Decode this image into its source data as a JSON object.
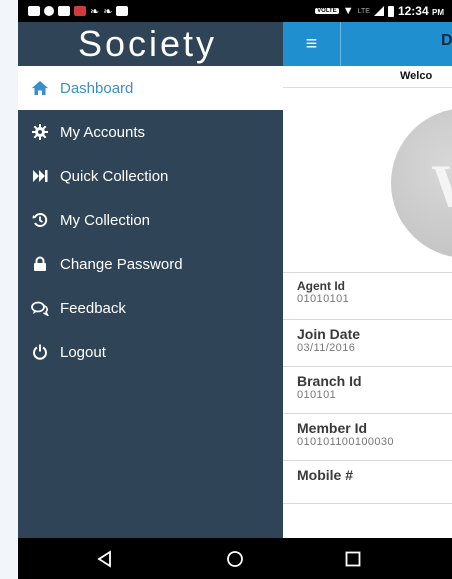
{
  "status_bar": {
    "time": "12:34",
    "time_suffix": "PM",
    "volte": "VOLTE",
    "lte": "LTE"
  },
  "drawer": {
    "title": "Society",
    "items": [
      {
        "label": "Dashboard",
        "icon": "home-icon",
        "active": true
      },
      {
        "label": "My Accounts",
        "icon": "gear-icon"
      },
      {
        "label": "Quick Collection",
        "icon": "fast-forward-icon"
      },
      {
        "label": "My Collection",
        "icon": "history-icon"
      },
      {
        "label": "Change Password",
        "icon": "lock-icon"
      },
      {
        "label": "Feedback",
        "icon": "comments-icon"
      },
      {
        "label": "Logout",
        "icon": "power-icon"
      }
    ]
  },
  "appbar": {
    "title_partial": "D",
    "menu_icon": "hamburger-icon"
  },
  "welcome": {
    "text_partial": "Welco"
  },
  "avatar": {
    "letter_partial": "W"
  },
  "profile": {
    "agent_id": {
      "label": "Agent Id",
      "value": "01010101"
    },
    "join_date": {
      "label": "Join Date",
      "value": "03/11/2016"
    },
    "branch_id": {
      "label": "Branch Id",
      "value": "010101"
    },
    "member_id": {
      "label": "Member Id",
      "value": "010101100100030"
    },
    "mobile": {
      "label": "Mobile #",
      "value": ""
    }
  },
  "colors": {
    "drawer_bg": "#2f4457",
    "accent": "#1f8fd0",
    "active_text": "#3a8ec9"
  }
}
